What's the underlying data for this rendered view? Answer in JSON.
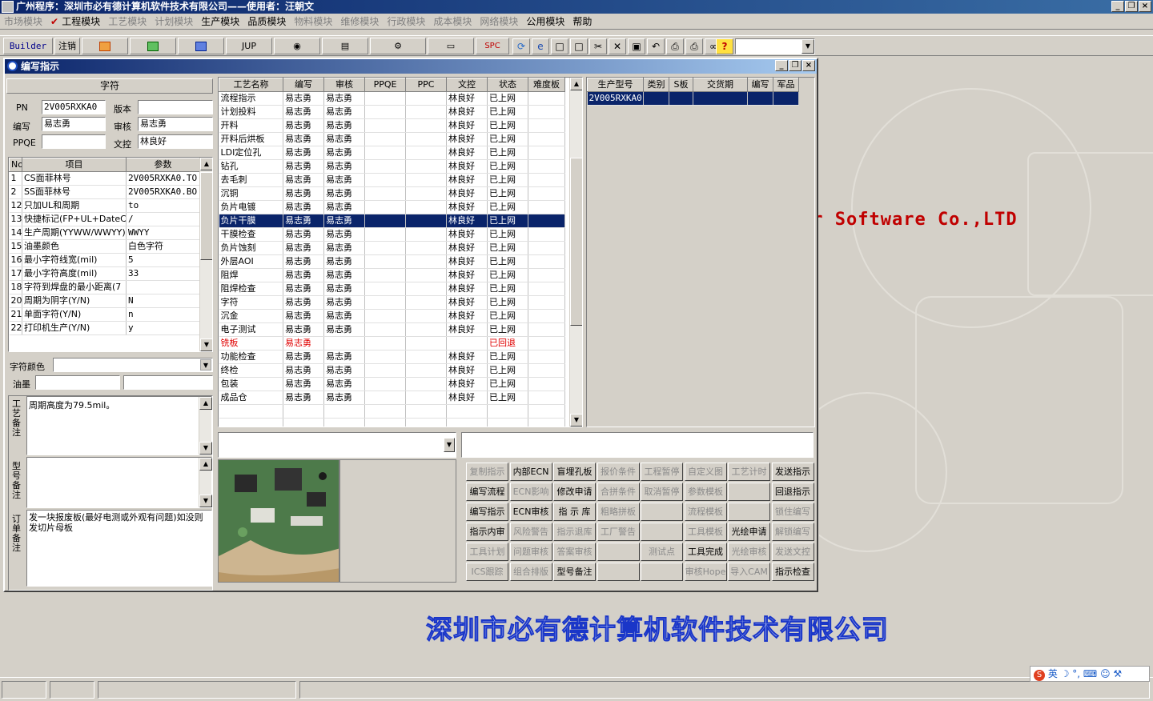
{
  "app": {
    "title": "广州程序：深圳市必有德计算机软件技术有限公司——使用者：汪朝文"
  },
  "menu": [
    {
      "label": "市场模块",
      "dim": true
    },
    {
      "label": "工程模块",
      "dim": false,
      "check": true
    },
    {
      "label": "工艺模块",
      "dim": true
    },
    {
      "label": "计划模块",
      "dim": true
    },
    {
      "label": "生产模块",
      "dim": false
    },
    {
      "label": "品质模块",
      "dim": false
    },
    {
      "label": "物料模块",
      "dim": true
    },
    {
      "label": "维修模块",
      "dim": true
    },
    {
      "label": "行政模块",
      "dim": true
    },
    {
      "label": "成本模块",
      "dim": true
    },
    {
      "label": "网络模块",
      "dim": true
    },
    {
      "label": "公用模块",
      "dim": false
    },
    {
      "label": "帮助",
      "dim": false
    }
  ],
  "toolbar": {
    "builder": "Builder",
    "logout": "注销",
    "jup": "JUP",
    "spc": "SPC"
  },
  "window": {
    "title": "编写指示"
  },
  "left": {
    "header": "字符",
    "pn_label": "PN",
    "pn_value": "2V005RXKA0",
    "version_label": "版本",
    "version_value": "",
    "writer_label": "编写",
    "writer_value": "易志勇",
    "review_label": "审核",
    "review_value": "易志勇",
    "ppqe_label": "PPQE",
    "ppqe_value": "",
    "doc_label": "文控",
    "doc_value": "林良好",
    "params_cols": [
      "No",
      "项目",
      "参数"
    ],
    "params": [
      {
        "no": "1",
        "item": "CS面菲林号",
        "value": "2V005RXKA0.TO"
      },
      {
        "no": "2",
        "item": "SS面菲林号",
        "value": "2V005RXKA0.BO"
      },
      {
        "no": "12",
        "item": "只加UL和周期",
        "value": "to"
      },
      {
        "no": "13",
        "item": "快捷标记(FP+UL+DateCo",
        "value": "/"
      },
      {
        "no": "14",
        "item": "生产周期(YYWW/WWYY)",
        "value": "WWYY"
      },
      {
        "no": "15",
        "item": "油墨颜色",
        "value": "白色字符"
      },
      {
        "no": "16",
        "item": "最小字符线宽(mil)",
        "value": "5"
      },
      {
        "no": "17",
        "item": "最小字符高度(mil)",
        "value": "33"
      },
      {
        "no": "18",
        "item": "字符到焊盘的最小距离(7",
        "value": ""
      },
      {
        "no": "20",
        "item": "周期为阴字(Y/N)",
        "value": "N"
      },
      {
        "no": "21",
        "item": "单面字符(Y/N)",
        "value": "n"
      },
      {
        "no": "22",
        "item": "打印机生产(Y/N)",
        "value": "y"
      }
    ],
    "char_color_label": "字符颜色",
    "char_color_value": "",
    "ink_label": "油墨",
    "ink_value1": "",
    "ink_value2": "",
    "process_note_label": "工艺备注",
    "process_note": "周期高度为79.5mil。",
    "model_note_label": "型号备注",
    "model_note": "",
    "order_note_label": "订单备注",
    "order_note": "发一块报废板(最好电测或外观有问题)如没则发切片母板"
  },
  "process": {
    "cols": [
      "工艺名称",
      "编写",
      "审核",
      "PPQE",
      "PPC",
      "文控",
      "状态",
      "难度板"
    ],
    "rows": [
      {
        "name": "流程指示",
        "w": "易志勇",
        "r": "易志勇",
        "doc": "林良好",
        "status": "已上网"
      },
      {
        "name": "计划投料",
        "w": "易志勇",
        "r": "易志勇",
        "doc": "林良好",
        "status": "已上网"
      },
      {
        "name": "开料",
        "w": "易志勇",
        "r": "易志勇",
        "doc": "林良好",
        "status": "已上网"
      },
      {
        "name": "开料后烘板",
        "w": "易志勇",
        "r": "易志勇",
        "doc": "林良好",
        "status": "已上网"
      },
      {
        "name": "LDI定位孔",
        "w": "易志勇",
        "r": "易志勇",
        "doc": "林良好",
        "status": "已上网"
      },
      {
        "name": "钻孔",
        "w": "易志勇",
        "r": "易志勇",
        "doc": "林良好",
        "status": "已上网"
      },
      {
        "name": "去毛刺",
        "w": "易志勇",
        "r": "易志勇",
        "doc": "林良好",
        "status": "已上网"
      },
      {
        "name": "沉铜",
        "w": "易志勇",
        "r": "易志勇",
        "doc": "林良好",
        "status": "已上网"
      },
      {
        "name": "负片电镀",
        "w": "易志勇",
        "r": "易志勇",
        "doc": "林良好",
        "status": "已上网"
      },
      {
        "name": "负片干膜",
        "w": "易志勇",
        "r": "易志勇",
        "doc": "林良好",
        "status": "已上网",
        "sel": true
      },
      {
        "name": "干膜检查",
        "w": "易志勇",
        "r": "易志勇",
        "doc": "林良好",
        "status": "已上网"
      },
      {
        "name": "负片蚀刻",
        "w": "易志勇",
        "r": "易志勇",
        "doc": "林良好",
        "status": "已上网"
      },
      {
        "name": "外层AOI",
        "w": "易志勇",
        "r": "易志勇",
        "doc": "林良好",
        "status": "已上网"
      },
      {
        "name": "阻焊",
        "w": "易志勇",
        "r": "易志勇",
        "doc": "林良好",
        "status": "已上网"
      },
      {
        "name": "阻焊检查",
        "w": "易志勇",
        "r": "易志勇",
        "doc": "林良好",
        "status": "已上网"
      },
      {
        "name": "字符",
        "w": "易志勇",
        "r": "易志勇",
        "doc": "林良好",
        "status": "已上网"
      },
      {
        "name": "沉金",
        "w": "易志勇",
        "r": "易志勇",
        "doc": "林良好",
        "status": "已上网"
      },
      {
        "name": "电子测试",
        "w": "易志勇",
        "r": "易志勇",
        "doc": "林良好",
        "status": "已上网"
      },
      {
        "name": "铣板",
        "w": "易志勇",
        "r": "",
        "doc": "",
        "status": "已回退",
        "red": true
      },
      {
        "name": "功能检查",
        "w": "易志勇",
        "r": "易志勇",
        "doc": "林良好",
        "status": "已上网"
      },
      {
        "name": "终检",
        "w": "易志勇",
        "r": "易志勇",
        "doc": "林良好",
        "status": "已上网"
      },
      {
        "name": "包装",
        "w": "易志勇",
        "r": "易志勇",
        "doc": "林良好",
        "status": "已上网"
      },
      {
        "name": "成品仓",
        "w": "易志勇",
        "r": "易志勇",
        "doc": "林良好",
        "status": "已上网"
      }
    ]
  },
  "models": {
    "cols": [
      "生产型号",
      "类别",
      "S板",
      "交货期",
      "编写",
      "军品"
    ],
    "rows": [
      {
        "model": "2V005RXKA0"
      }
    ]
  },
  "buttons": [
    {
      "label": "复制指示",
      "dis": true
    },
    {
      "label": "内部ECN",
      "dis": false
    },
    {
      "label": "盲埋孔板",
      "dis": false
    },
    {
      "label": "报价条件",
      "dis": true
    },
    {
      "label": "工程暂停",
      "dis": true
    },
    {
      "label": "自定义图",
      "dis": true
    },
    {
      "label": "工艺计时",
      "dis": true
    },
    {
      "label": "发送指示",
      "dis": false
    },
    {
      "label": "编写流程",
      "dis": false
    },
    {
      "label": "ECN影响",
      "dis": true
    },
    {
      "label": "修改申请",
      "dis": false
    },
    {
      "label": "合拼条件",
      "dis": true
    },
    {
      "label": "取消暂停",
      "dis": true
    },
    {
      "label": "参数模板",
      "dis": true
    },
    {
      "label": "",
      "dis": true
    },
    {
      "label": "回退指示",
      "dis": false
    },
    {
      "label": "编写指示",
      "dis": false
    },
    {
      "label": "ECN审核",
      "dis": false
    },
    {
      "label": "指 示 库",
      "dis": false
    },
    {
      "label": "粗略拼板",
      "dis": true
    },
    {
      "label": "",
      "dis": true
    },
    {
      "label": "流程模板",
      "dis": true
    },
    {
      "label": "",
      "dis": true
    },
    {
      "label": "锁住编写",
      "dis": true
    },
    {
      "label": "指示内审",
      "dis": false
    },
    {
      "label": "风险警告",
      "dis": true
    },
    {
      "label": "指示退库",
      "dis": true
    },
    {
      "label": "工厂警告",
      "dis": true
    },
    {
      "label": "",
      "dis": true
    },
    {
      "label": "工具模板",
      "dis": true
    },
    {
      "label": "光绘申请",
      "dis": false
    },
    {
      "label": "解锁编写",
      "dis": true
    },
    {
      "label": "工具计划",
      "dis": true
    },
    {
      "label": "问题审核",
      "dis": true
    },
    {
      "label": "答案审核",
      "dis": true
    },
    {
      "label": "",
      "dis": true
    },
    {
      "label": "测试点",
      "dis": true
    },
    {
      "label": "工具完成",
      "dis": false
    },
    {
      "label": "光绘审核",
      "dis": true
    },
    {
      "label": "发送文控",
      "dis": true
    },
    {
      "label": "ICS跟踪",
      "dis": true
    },
    {
      "label": "组合排版",
      "dis": true
    },
    {
      "label": "型号备注",
      "dis": false
    },
    {
      "label": "",
      "dis": true
    },
    {
      "label": "",
      "dis": true
    },
    {
      "label": "审核Hope",
      "dis": true
    },
    {
      "label": "导入CAM",
      "dis": true
    },
    {
      "label": "指示检查",
      "dis": false
    }
  ],
  "brand": {
    "en": "er Software Co.,LTD",
    "cn": "深圳市必有德计算机软件技术有限公司"
  },
  "ime": {
    "text": "英"
  }
}
